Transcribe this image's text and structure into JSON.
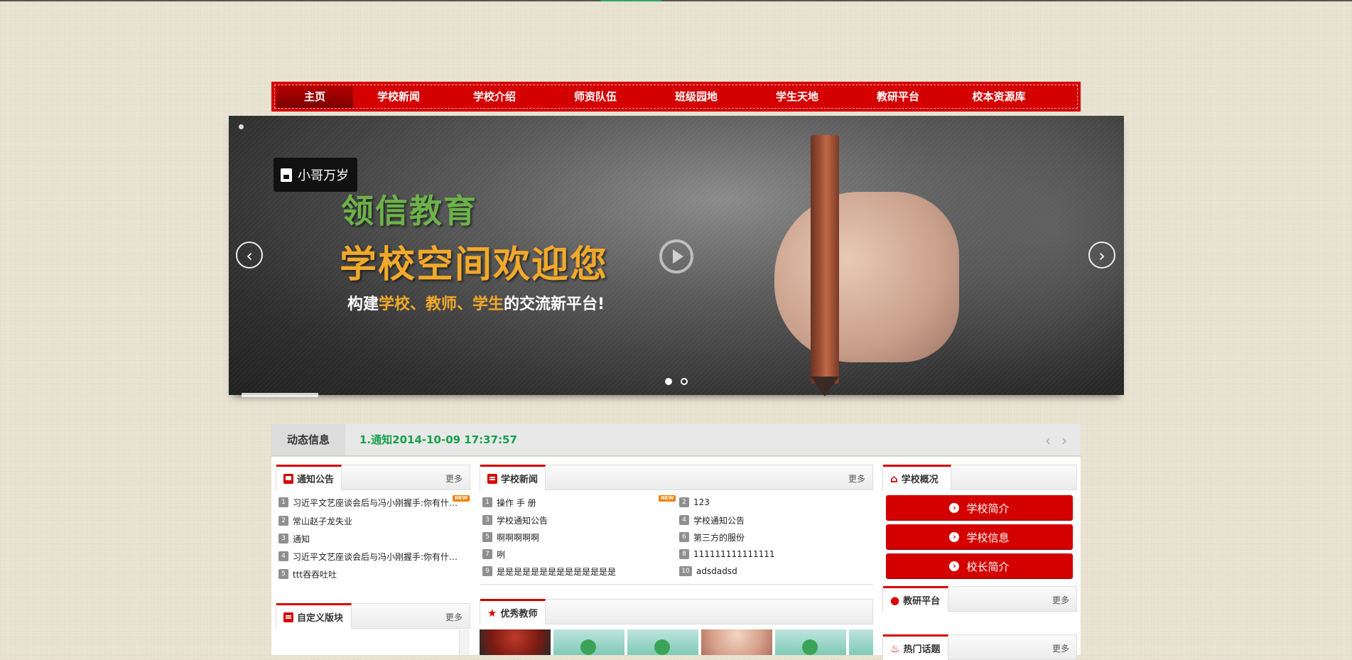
{
  "nav": {
    "items": [
      "主页",
      "学校新闻",
      "学校介绍",
      "师资队伍",
      "班级园地",
      "学生天地",
      "教研平台",
      "校本资源库"
    ],
    "active_index": 0
  },
  "banner": {
    "tag_label": "小哥万岁",
    "title_line1": "领信教育",
    "title_line2": "学校空间欢迎您",
    "subtitle_prefix": "构建",
    "subtitle_hl1": "学校、教师、学生",
    "subtitle_suffix": "的交流新平台!",
    "prev_arrow": "‹",
    "next_arrow": "›",
    "slide_count": 2,
    "active_slide": 0
  },
  "ticker": {
    "label": "动态信息",
    "text": "1.通知2014-10-09 17:37:57",
    "prev_arrow": "‹",
    "next_arrow": "›"
  },
  "notice": {
    "title": "通知公告",
    "more": "更多",
    "icon": "speech-bubble-icon",
    "items": [
      {
        "num": "1",
        "text": "习近平文艺座谈会后与冯小刚握手:你有什…",
        "is_new": true
      },
      {
        "num": "2",
        "text": "常山赵子龙失业",
        "is_new": false
      },
      {
        "num": "3",
        "text": "通知",
        "is_new": false
      },
      {
        "num": "4",
        "text": "习近平文艺座谈会后与冯小刚握手:你有什…",
        "is_new": false
      },
      {
        "num": "5",
        "text": "ttt吞吞吐吐",
        "is_new": false
      }
    ],
    "new_badge": "NEW"
  },
  "school_news": {
    "title": "学校新闻",
    "more": "更多",
    "icon": "document-icon",
    "items": [
      {
        "num": "1",
        "text": "操作 手 册",
        "is_new": true
      },
      {
        "num": "2",
        "text": "123",
        "is_new": false
      },
      {
        "num": "3",
        "text": "学校通知公告",
        "is_new": false
      },
      {
        "num": "4",
        "text": "学校通知公告",
        "is_new": false
      },
      {
        "num": "5",
        "text": "啊啊啊啊啊",
        "is_new": false
      },
      {
        "num": "6",
        "text": "第三方的服份",
        "is_new": false
      },
      {
        "num": "7",
        "text": "咧",
        "is_new": false
      },
      {
        "num": "8",
        "text": "111111111111111",
        "is_new": false
      },
      {
        "num": "9",
        "text": "是是是是是是是是是是是是是是",
        "is_new": false
      },
      {
        "num": "10",
        "text": "adsdadsd",
        "is_new": false
      }
    ]
  },
  "overview": {
    "title": "学校概况",
    "icon": "bank-icon",
    "buttons": [
      "学校简介",
      "学校信息",
      "校长简介"
    ]
  },
  "research": {
    "title": "教研平台",
    "more": "更多",
    "icon": "chat-icon"
  },
  "hot_topics": {
    "title": "热门话题",
    "more": "更多",
    "icon": "flame-icon"
  },
  "custom_block": {
    "title": "自定义版块",
    "more": "更多",
    "icon": "copy-icon"
  },
  "teachers": {
    "title": "优秀教师",
    "icon": "star-icon"
  },
  "colors": {
    "brand_red": "#d40000",
    "ticker_green": "#17a04a",
    "banner_orange": "#f2a92b",
    "banner_green": "#6db24a"
  }
}
